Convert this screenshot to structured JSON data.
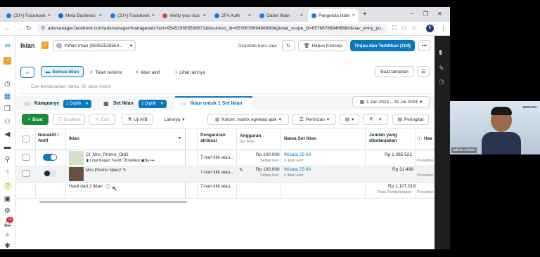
{
  "browser": {
    "tabs": [
      {
        "label": "(20+) Facebook",
        "color": "#1877f2"
      },
      {
        "label": "Meta Business",
        "color": "#0668e1"
      },
      {
        "label": "(20+) Facebook",
        "color": "#1877f2"
      },
      {
        "label": "Verify your bus",
        "color": "#ea4335"
      },
      {
        "label": "2FA Auth",
        "color": "#1a73e8"
      },
      {
        "label": "Galeri Iklan",
        "color": "#1877f2"
      },
      {
        "label": "Pengelola Iklan",
        "color": "#1877f2"
      }
    ],
    "new_tab": "+",
    "url": "adsmanager.facebook.com/adsmanager/manage/ads?act=954525655536671&business_id=657667889466680&global_scope_id=657667889466680&nav_entry_po...",
    "profile": "K"
  },
  "header": {
    "title": "Iklan",
    "account_badge": "J",
    "account_name": "Yohan Iman (95452526553...",
    "updated": "Diupdate baru saja",
    "discard": "Hapus Konsep",
    "publish": "Tinjau dan Terbitkan (104)"
  },
  "filters": {
    "all": "Semua iklan",
    "sent": "Telah terkirim",
    "active": "Iklan aktif",
    "more": "Lihat lainnya",
    "view": "Buat tampilan",
    "search_placeholder": "Cari berdasarkan nama, ID, atau metrik"
  },
  "levels": {
    "campaign": "Kampanye",
    "campaign_sel": "1 Dipilih",
    "adset": "Set Iklan",
    "adset_sel": "1 Dipilih",
    "ads": "Iklan untuk 1 Set Iklan",
    "date": "1 Jan 2024 – 31 Jul 2024"
  },
  "toolbar": {
    "create": "Buat",
    "duplicate": "Duplikat",
    "edit": "Edit",
    "abtest": "Uji A/B",
    "more": "Lainnya",
    "columns": "Kolom: matrix ngelead apik",
    "breakdown": "Perincian",
    "reports": "Peringkat"
  },
  "table": {
    "headers": {
      "toggle": "Nonaktif / Aktif",
      "ad": "Iklan",
      "attribution": "Pengaturan atribusi",
      "budget": "Anggaran",
      "budget_sub": "Set Iklan",
      "adset": "Nama Set Iklan",
      "spent": "Jumlah yang dibelanjakan",
      "more": "Has"
    },
    "rows": [
      {
        "on": true,
        "name": "Cl_Mrs_Promo_Old1",
        "actions": [
          "Lihat Bagan",
          "Edit",
          "Duplikat",
          "Ba",
          "•••"
        ],
        "attribution": "7-hari klik atau...",
        "budget": "Rp 100.000",
        "budget_sub": "Setiap hari",
        "adset": "Wisata 25-60",
        "adset_sub": "0 iklan aktif",
        "spent": "Rp 1.085.521",
        "more": "Penambe"
      },
      {
        "on": false,
        "name": "Mrs Promo New2",
        "attribution": "7-hari klik atau...",
        "budget": "Rp 100.000",
        "budget_sub": "Setiap hari",
        "adset": "Wisata 25-60",
        "adset_sub": "0 iklan aktif",
        "spent": "Rp 21.498",
        "more": "Penambe"
      }
    ],
    "summary": {
      "label": "Hasil dari 2 iklan",
      "attribution": "7-hari klik atau...",
      "spent": "Rp 1.107.019",
      "spent_sub": "Total Pembelanjaan",
      "more": "Penambe"
    }
  },
  "rail_badge": "70",
  "video": {
    "caption": "admin admin",
    "logo": "DEMARA"
  }
}
